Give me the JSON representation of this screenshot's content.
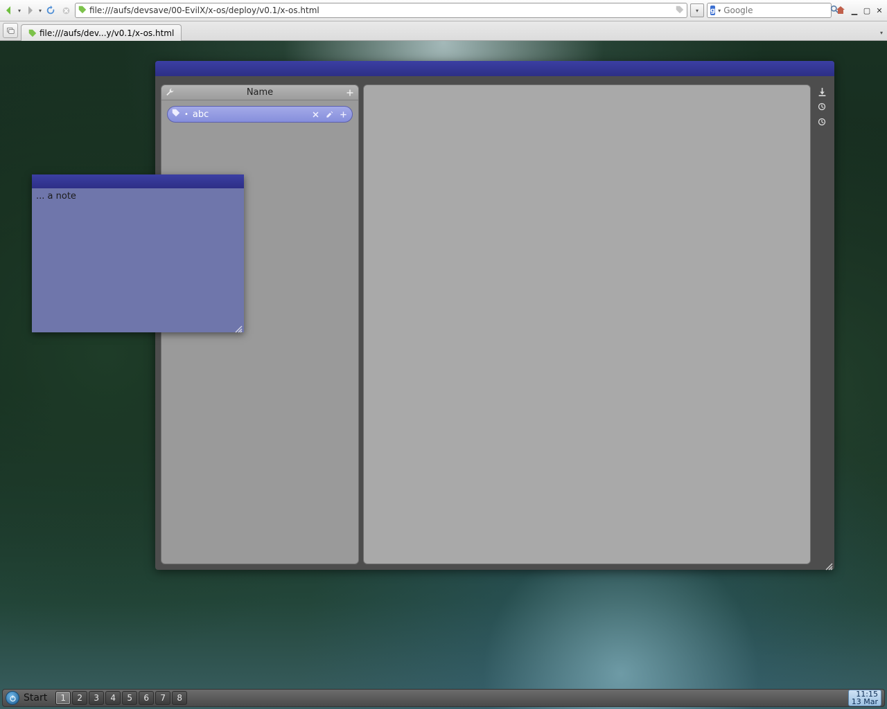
{
  "browser": {
    "url": "file:///aufs/devsave/00-EvilX/x-os/deploy/v0.1/x-os.html",
    "search_placeholder": "Google",
    "tab_label": "file:///aufs/dev...y/v0.1/x-os.html"
  },
  "app": {
    "left_panel": {
      "header_title": "Name",
      "items": [
        {
          "label": "abc"
        }
      ]
    }
  },
  "note": {
    "text": "... a note"
  },
  "taskbar": {
    "start_label": "Start",
    "workspaces": [
      "1",
      "2",
      "3",
      "4",
      "5",
      "6",
      "7",
      "8"
    ],
    "active_workspace": 0,
    "time": "11:15",
    "date": "13 Mar"
  }
}
